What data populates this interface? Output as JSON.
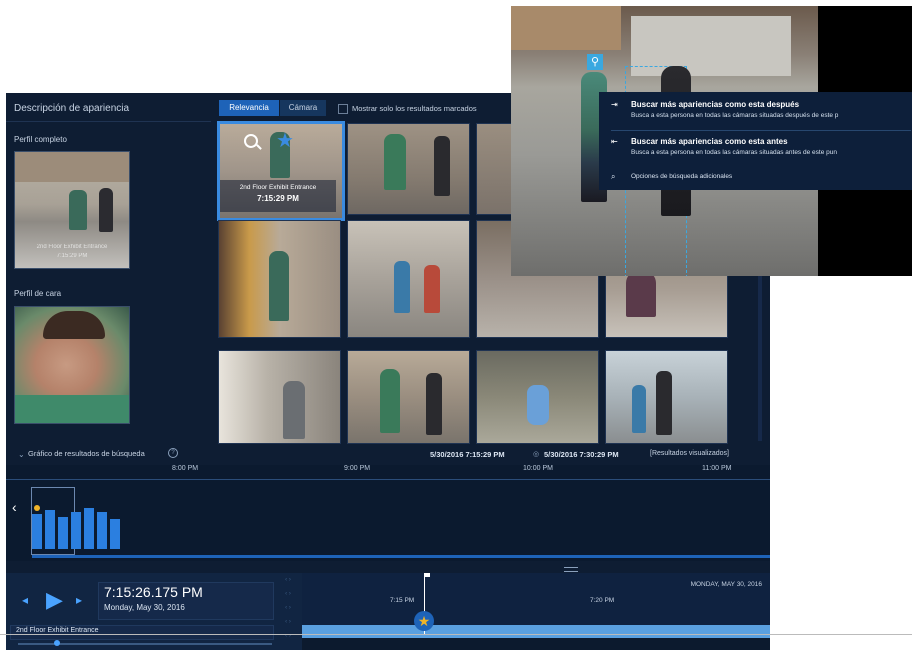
{
  "left_panel": {
    "title": "Descripción de apariencia",
    "full_profile_label": "Perfil completo",
    "full_profile_caption_camera": "2nd Floor Exhibit Entrance",
    "full_profile_caption_time": "7:15:29 PM",
    "face_profile_label": "Perfil de cara"
  },
  "results_toolbar": {
    "sort_relevance": "Relevancia",
    "sort_camera": "Cámara",
    "show_marked_only": "Mostrar solo los resultados marcados"
  },
  "selected_result": {
    "camera": "2nd Floor Exhibit Entrance",
    "time": "7:15:29 PM"
  },
  "results_graph": {
    "title": "Gráfico de resultados de búsqueda",
    "range_start": "5/30/2016 7:15:29 PM",
    "range_end": "5/30/2016 7:30:29 PM",
    "range_note": "[Resultados visualizados]",
    "ticks": [
      "8:00 PM",
      "9:00 PM",
      "10:00 PM",
      "11:00 PM"
    ],
    "bars": [
      0.75,
      0.85,
      0.7,
      0.8,
      0.9,
      0.8,
      0.65
    ]
  },
  "playback": {
    "time": "7:15:26.175 PM",
    "date": "Monday, May 30, 2016",
    "camera": "2nd Floor Exhibit Entrance",
    "timeline_date": "MONDAY, MAY 30, 2016",
    "tick_1": "7:15 PM",
    "tick_2": "7:20 PM"
  },
  "context_menu": {
    "item_after_title": "Buscar más apariencias como esta después",
    "item_after_sub": "Busca a esta persona en todas las cámaras situadas después de este p",
    "item_before_title": "Buscar más apariencias como esta antes",
    "item_before_sub": "Busca a esta persona en todas las cámaras situadas antes de este pun",
    "item_options": "Opciones de búsqueda adicionales"
  },
  "icons": {
    "search": "search-icon",
    "star": "star-icon",
    "play": "play-icon",
    "prev": "previous-frame-icon",
    "next": "next-frame-icon",
    "chevron_left": "chevron-left-icon",
    "help": "help-icon",
    "person": "person-icon"
  },
  "colors": {
    "background": "#0e1d33",
    "accent": "#2b7fe0",
    "selected_tab": "#1e63b8",
    "highlight_border": "#3a8be0",
    "star": "#f0b429"
  }
}
